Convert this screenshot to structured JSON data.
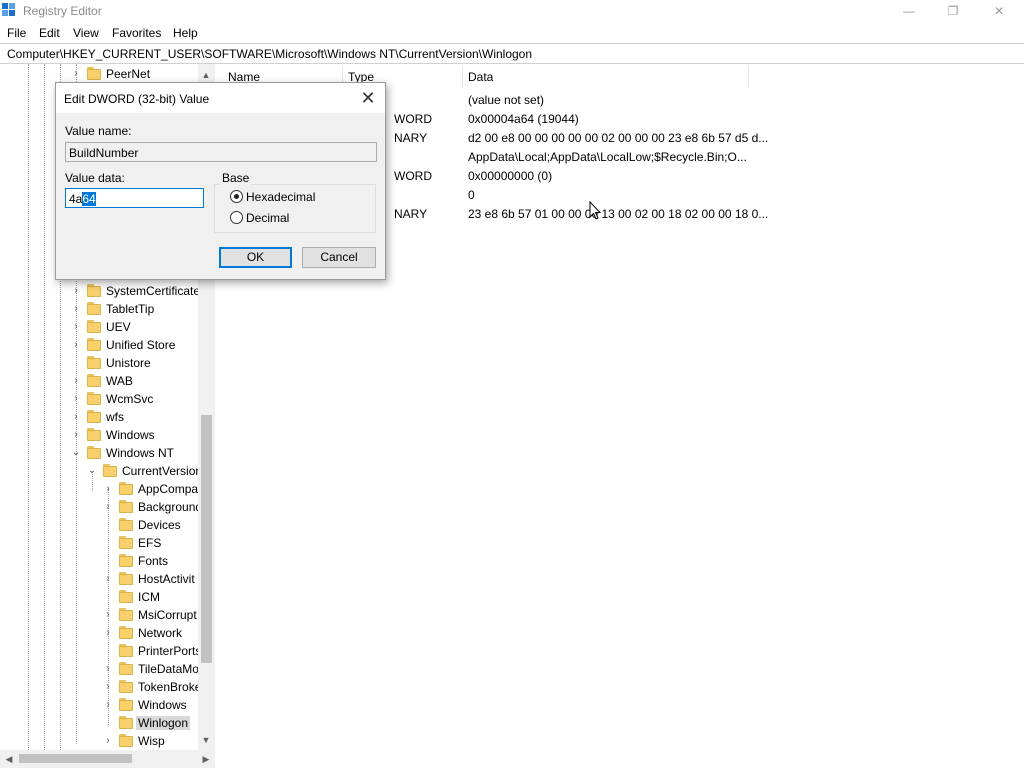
{
  "window": {
    "title": "Registry Editor",
    "minimize_glyph": "—",
    "restore_glyph": "❐",
    "close_glyph": "✕"
  },
  "menu": [
    "File",
    "Edit",
    "View",
    "Favorites",
    "Help"
  ],
  "address": "Computer\\HKEY_CURRENT_USER\\SOFTWARE\\Microsoft\\Windows NT\\CurrentVersion\\Winlogon",
  "tree": {
    "items": [
      {
        "label": "PeerNet",
        "expander": "›"
      },
      {
        "label": "SystemCertificate",
        "expander": "›"
      },
      {
        "label": "TabletTip",
        "expander": "›"
      },
      {
        "label": "UEV",
        "expander": "›"
      },
      {
        "label": "Unified Store",
        "expander": "›"
      },
      {
        "label": "Unistore",
        "expander": ""
      },
      {
        "label": "WAB",
        "expander": "›"
      },
      {
        "label": "WcmSvc",
        "expander": "›"
      },
      {
        "label": "wfs",
        "expander": "›"
      },
      {
        "label": "Windows",
        "expander": "›"
      },
      {
        "label": "Windows NT",
        "expander": "⌄"
      },
      {
        "label": "CurrentVersion",
        "expander": "⌄"
      },
      {
        "label": "AppCompa",
        "expander": "›"
      },
      {
        "label": "Background",
        "expander": "›"
      },
      {
        "label": "Devices",
        "expander": ""
      },
      {
        "label": "EFS",
        "expander": ""
      },
      {
        "label": "Fonts",
        "expander": ""
      },
      {
        "label": "HostActivit",
        "expander": "›"
      },
      {
        "label": "ICM",
        "expander": ""
      },
      {
        "label": "MsiCorrupt",
        "expander": "›"
      },
      {
        "label": "Network",
        "expander": "›"
      },
      {
        "label": "PrinterPorts",
        "expander": ""
      },
      {
        "label": "TileDataMo",
        "expander": "›"
      },
      {
        "label": "TokenBroke",
        "expander": "›"
      },
      {
        "label": "Windows",
        "expander": "›"
      },
      {
        "label": "Winlogon",
        "expander": "",
        "selected": true
      },
      {
        "label": "Wisp",
        "expander": "›"
      }
    ]
  },
  "list": {
    "columns": [
      "Name",
      "Type",
      "Data"
    ],
    "rows": [
      {
        "type": "",
        "data": "(value not set)"
      },
      {
        "type": "WORD",
        "data": "0x00004a64 (19044)"
      },
      {
        "type": "NARY",
        "data": "d2 00 e8 00 00 00 00 00 02 00 00 00 23 e8 6b 57 d5 d..."
      },
      {
        "type": "",
        "data": "AppData\\Local;AppData\\LocalLow;$Recycle.Bin;O..."
      },
      {
        "type": "WORD",
        "data": "0x00000000 (0)"
      },
      {
        "type": "",
        "data": "0"
      },
      {
        "type": "NARY",
        "data": "23 e8 6b 57 01 00 00 00 13 00 02 00 18 02 00 00 18 0..."
      }
    ]
  },
  "dialog": {
    "title": "Edit DWORD (32-bit) Value",
    "value_name_label": "Value name:",
    "value_name": "BuildNumber",
    "value_data_label": "Value data:",
    "value_data_prefix": "4a",
    "value_data_selected": "64",
    "base_label": "Base",
    "hex_label": "Hexadecimal",
    "dec_label": "Decimal",
    "base_selected": "Hexadecimal",
    "ok_label": "OK",
    "cancel_label": "Cancel"
  }
}
